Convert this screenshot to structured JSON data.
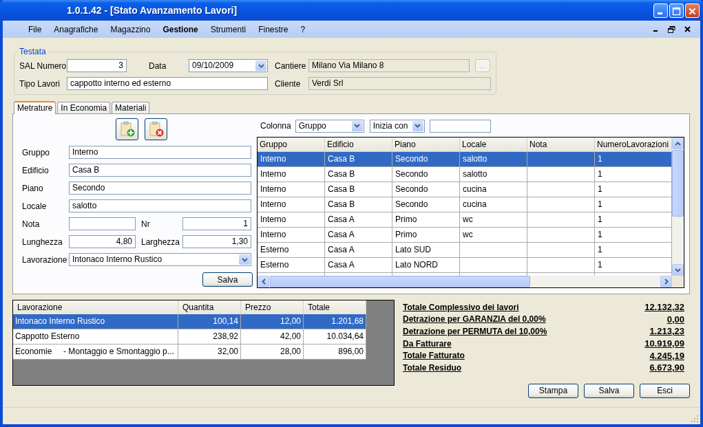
{
  "window": {
    "title": "1.0.1.42 - [Stato Avanzamento Lavori]"
  },
  "menu": [
    {
      "label": "File",
      "selected": false
    },
    {
      "label": "Anagrafiche",
      "selected": false
    },
    {
      "label": "Magazzino",
      "selected": false
    },
    {
      "label": "Gestione",
      "selected": true
    },
    {
      "label": "Strumenti",
      "selected": false
    },
    {
      "label": "Finestre",
      "selected": false
    },
    {
      "label": "?",
      "selected": false
    }
  ],
  "testata": {
    "title": "Testata",
    "sal_numero": {
      "label": "SAL Numero",
      "value": "3"
    },
    "data": {
      "label": "Data",
      "value": "09/10/2009"
    },
    "cantiere": {
      "label": "Cantiere",
      "value": "Milano Via Milano 8"
    },
    "browse_button": {
      "label": "...",
      "disabled": true
    },
    "tipo_lavori": {
      "label": "Tipo Lavori",
      "value": "cappotto interno ed esterno"
    },
    "cliente": {
      "label": "Cliente",
      "value": "Verdi Srl"
    }
  },
  "tabs": [
    {
      "label": "Metrature",
      "selected": true
    },
    {
      "label": "In Economia",
      "selected": false
    },
    {
      "label": "Materiali",
      "selected": false
    }
  ],
  "form": {
    "gruppo": {
      "label": "Gruppo",
      "value": "Interno"
    },
    "edificio": {
      "label": "Edificio",
      "value": "Casa B"
    },
    "piano": {
      "label": "Piano",
      "value": "Secondo"
    },
    "locale": {
      "label": "Locale",
      "value": "salotto"
    },
    "nota": {
      "label": "Nota"
    },
    "nr": {
      "label": "Nr",
      "value": "1"
    },
    "lunghezza": {
      "label": "Lunghezza",
      "value": "4,80"
    },
    "larghezza": {
      "label": "Larghezza",
      "value": "1,30"
    },
    "lavorazione": {
      "label": "Lavorazione",
      "value": "Intonaco Interno Rustico"
    },
    "save_button": "Salva"
  },
  "filter": {
    "label": "Colonna",
    "column": "Gruppo",
    "mode": "Inizia con"
  },
  "grid": {
    "columns": [
      "Gruppo",
      "Edificio",
      "Piano",
      "Locale",
      "Nota",
      "NumeroLavorazioni"
    ],
    "rows": [
      {
        "gruppo": "Interno",
        "edificio": "Casa B",
        "piano": "Secondo",
        "locale": "salotto",
        "numero": "1",
        "selected": true
      },
      {
        "gruppo": "Interno",
        "edificio": "Casa B",
        "piano": "Secondo",
        "locale": "salotto",
        "numero": "1",
        "selected": false
      },
      {
        "gruppo": "Interno",
        "edificio": "Casa B",
        "piano": "Secondo",
        "locale": "cucina",
        "numero": "1",
        "selected": false
      },
      {
        "gruppo": "Interno",
        "edificio": "Casa B",
        "piano": "Secondo",
        "locale": "cucina",
        "numero": "1",
        "selected": false
      },
      {
        "gruppo": "Interno",
        "edificio": "Casa A",
        "piano": "Primo",
        "locale": "wc",
        "numero": "1",
        "selected": false
      },
      {
        "gruppo": "Interno",
        "edificio": "Casa A",
        "piano": "Primo",
        "locale": "wc",
        "numero": "1",
        "selected": false
      },
      {
        "gruppo": "Esterno",
        "edificio": "Casa A",
        "piano": "Lato SUD",
        "numero": "1",
        "selected": false
      },
      {
        "gruppo": "Esterno",
        "edificio": "Casa A",
        "piano": "Lato NORD",
        "numero": "1",
        "selected": false
      }
    ]
  },
  "works": {
    "columns": [
      "Lavorazione",
      "Quantita",
      "Prezzo",
      "Totale"
    ],
    "rows": [
      {
        "lavorazione": "Intonaco Interno Rustico",
        "quantita": "100,14",
        "prezzo": "12,00",
        "totale": "1.201,68",
        "selected": true
      },
      {
        "lavorazione": "Cappotto Esterno",
        "quantita": "238,92",
        "prezzo": "42,00",
        "totale": "10.034,64",
        "selected": false
      },
      {
        "lavorazione": "Economie     - Montaggio e Smontaggio p...",
        "quantita": "32,00",
        "prezzo": "28,00",
        "totale": "896,00",
        "selected": false
      }
    ]
  },
  "totals": [
    {
      "label": "Totale Complessivo dei lavori",
      "value": "12.132,32"
    },
    {
      "label": "Detrazione per GARANZIA del 0,00%",
      "value": "0,00"
    },
    {
      "label": "Detrazione per PERMUTA del 10,00%",
      "value": "1.213,23"
    },
    {
      "label": "Da Fatturare",
      "value": "10.919,09"
    },
    {
      "label": "Totale Fatturato",
      "value": "4.245,19"
    },
    {
      "label": "Totale Residuo",
      "value": "6.673,90"
    }
  ],
  "buttons": [
    "Stampa",
    "Salva",
    "Esci"
  ]
}
